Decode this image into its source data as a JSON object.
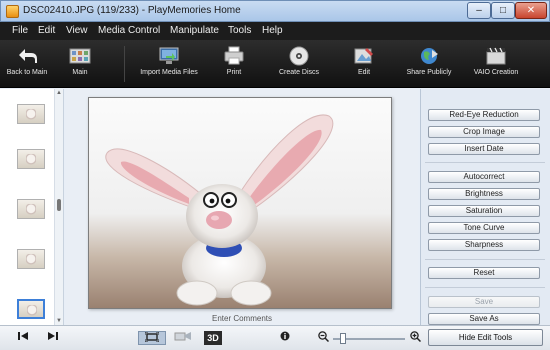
{
  "window": {
    "title": "DSC02410.JPG (119/233)  -  PlayMemories Home",
    "minimize": "–",
    "maximize": "□",
    "close": "✕"
  },
  "menu": [
    "File",
    "Edit",
    "View",
    "Media Control",
    "Manipulate",
    "Tools",
    "Help"
  ],
  "toolbar": {
    "back": "Back to Main",
    "main": "Main",
    "import": "Import Media Files",
    "print": "Print",
    "discs": "Create Discs",
    "edit": "Edit",
    "share": "Share Publicly",
    "vaio": "VAIO Creation"
  },
  "viewer": {
    "comments_placeholder": "Enter Comments"
  },
  "edit_panel": {
    "red_eye": "Red-Eye Reduction",
    "crop": "Crop Image",
    "insert_date": "Insert Date",
    "autocorrect": "Autocorrect",
    "brightness": "Brightness",
    "saturation": "Saturation",
    "tone_curve": "Tone Curve",
    "sharpness": "Sharpness",
    "reset": "Reset",
    "save": "Save",
    "save_as": "Save As"
  },
  "bottom": {
    "mode_3d": "3D",
    "hide_edit_tools": "Hide Edit Tools",
    "zoom_fraction": 0.1
  },
  "colors": {
    "selection": "#3d7fd8",
    "toolbar_bg": "#1c1c1c"
  }
}
